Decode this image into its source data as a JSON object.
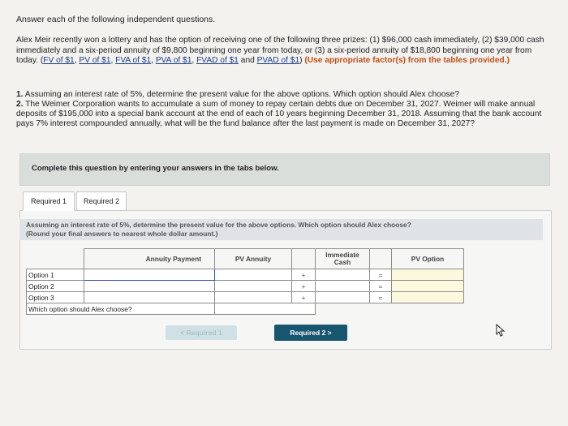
{
  "heading": "Answer each of the following independent questions.",
  "intro": {
    "text1": "Alex Meir recently won a lottery and has the option of receiving one of the following three prizes: (1) $96,000 cash immediately, (2) $39,000 cash immediately and a six-period annuity of $9,800 beginning one year from today, or (3) a six-period annuity of $18,800 beginning one year from today. (",
    "links": [
      "FV of $1",
      "PV of $1",
      "FVA of $1",
      "PVA of $1",
      "FVAD of $1",
      "PVAD of $1"
    ],
    "sep_comma": ", ",
    "sep_and": " and ",
    "close_paren": ")",
    "highlight": "(Use appropriate factor(s) from the tables provided.)"
  },
  "questions": {
    "q1_num": "1.",
    "q1_text": "Assuming an interest rate of 5%, determine the present value for the above options. Which option should Alex choose?",
    "q2_num": "2.",
    "q2_text": "The Weimer Corporation wants to accumulate a sum of money to repay certain debts due on December 31, 2027. Weimer will make annual deposits of $195,000 into a special bank account at the end of each of 10 years beginning December 31, 2018. Assuming that the bank account pays 7% interest compounded annually, what will be the fund balance after the last payment is made on December 31, 2027?"
  },
  "complete_prompt": "Complete this question by entering your answers in the tabs below.",
  "tabs": [
    {
      "label": "Required 1"
    },
    {
      "label": "Required 2"
    }
  ],
  "instruction": {
    "line1": "Assuming an interest rate of 5%, determine the present value for the above options. Which option should Alex choose?",
    "line2": "(Round your final answers to nearest whole dollar amount.)"
  },
  "table": {
    "headers": {
      "annuity_payment": "Annuity Payment",
      "pv_annuity": "PV Annuity",
      "immediate_cash": "Immediate Cash",
      "pv_option": "PV Option"
    },
    "rows": [
      {
        "label": "Option 1",
        "plus": "+",
        "equals": "="
      },
      {
        "label": "Option 2",
        "plus": "+",
        "equals": "="
      },
      {
        "label": "Option 3",
        "plus": "+",
        "equals": "="
      }
    ],
    "choose_label": "Which option should Alex choose?"
  },
  "nav": {
    "prev_label": "< Required 1",
    "next_label": "Required 2 >"
  },
  "icons": {
    "cursor": "pointer-cursor-icon"
  }
}
